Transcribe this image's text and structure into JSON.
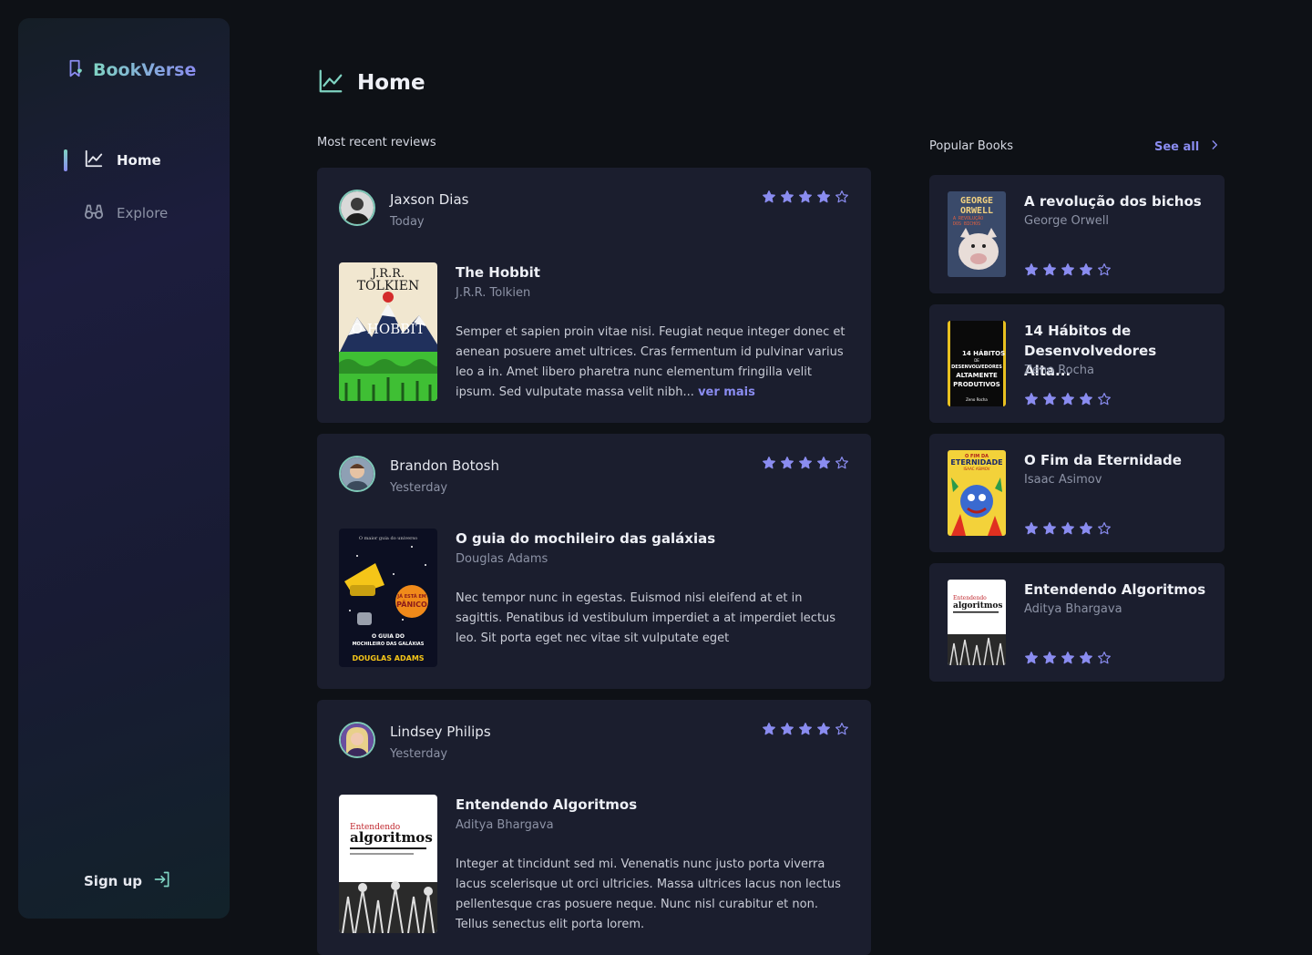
{
  "app": {
    "name": "BookVerse"
  },
  "nav": {
    "items": [
      {
        "label": "Home",
        "icon": "chart-line-icon",
        "active": true
      },
      {
        "label": "Explore",
        "icon": "binoculars-icon",
        "active": false
      }
    ],
    "signup_label": "Sign up"
  },
  "page": {
    "title": "Home"
  },
  "reviews_section": {
    "label": "Most recent reviews"
  },
  "popular_section": {
    "label": "Popular Books",
    "see_all": "See all"
  },
  "colors": {
    "accent": "#8a8cf0",
    "teal": "#7fd3c2",
    "card": "#1b1e2e",
    "background": "#0e1116",
    "star": "#8a8cf0"
  },
  "reviews": [
    {
      "reviewer": "Jaxson Dias",
      "date": "Today",
      "rating": 4,
      "book_title": "The Hobbit",
      "book_author": "J.R.R. Tolkien",
      "text": "Semper et sapien proin vitae nisi. Feugiat neque integer donec et aenean posuere amet ultrices. Cras fermentum id pulvinar varius leo a in. Amet libero pharetra nunc elementum fringilla velit ipsum. Sed vulputate massa velit nibh...",
      "more_label": "ver mais"
    },
    {
      "reviewer": "Brandon Botosh",
      "date": "Yesterday",
      "rating": 4,
      "book_title": "O guia do mochileiro das galáxias",
      "book_author": "Douglas Adams",
      "text": "Nec tempor nunc in egestas. Euismod nisi eleifend at et in sagittis. Penatibus id vestibulum imperdiet a at imperdiet lectus leo. Sit porta eget nec vitae sit vulputate eget"
    },
    {
      "reviewer": "Lindsey Philips",
      "date": "Yesterday",
      "rating": 4,
      "book_title": "Entendendo Algoritmos",
      "book_author": "Aditya Bhargava",
      "text": "Integer at tincidunt sed mi. Venenatis nunc justo porta viverra lacus scelerisque ut orci ultricies. Massa ultrices lacus non lectus pellentesque cras posuere neque. Nunc nisl curabitur et non. Tellus senectus elit porta lorem."
    }
  ],
  "popular": [
    {
      "title": "A revolução dos bichos",
      "author": "George Orwell",
      "rating": 4
    },
    {
      "title": "14 Hábitos de Desenvolvedores Alta...",
      "author": "Zeno Rocha",
      "rating": 4
    },
    {
      "title": "O Fim da Eternidade",
      "author": "Isaac Asimov",
      "rating": 4
    },
    {
      "title": "Entendendo Algoritmos",
      "author": "Aditya Bhargava",
      "rating": 4
    }
  ],
  "covers": {
    "hobbit": {
      "line1": "J.R.R.",
      "line2": "TOLKIEN",
      "line3": "O HOBBIT"
    },
    "guia": {
      "tagline": "O maior guia do universo",
      "badge_line1": "JÁ ESTÁ EM",
      "badge_line2": "PÂNICO",
      "title_line1": "O GUIA DO",
      "title_line2": "MOCHILEIRO DAS GALÁXIAS",
      "author": "DOUGLAS ADAMS"
    },
    "algoritmos": {
      "line1": "Entendendo",
      "line2": "algoritmos"
    },
    "orwell": {
      "line1": "GEORGE",
      "line2": "ORWELL",
      "line3": "A REVOLUÇÃO",
      "line4": "DOS BICHOS"
    },
    "habitos": {
      "line1": "14 HÁBITOS",
      "line2": "DE",
      "line3": "DESENVOLVEDORES",
      "line4": "ALTAMENTE",
      "line5": "PRODUTIVOS",
      "author": "Zeno Rocha"
    },
    "eternidade": {
      "line1": "O FIM DA",
      "line2": "ETERNIDADE",
      "line3": "ISAAC ASIMOV"
    }
  }
}
